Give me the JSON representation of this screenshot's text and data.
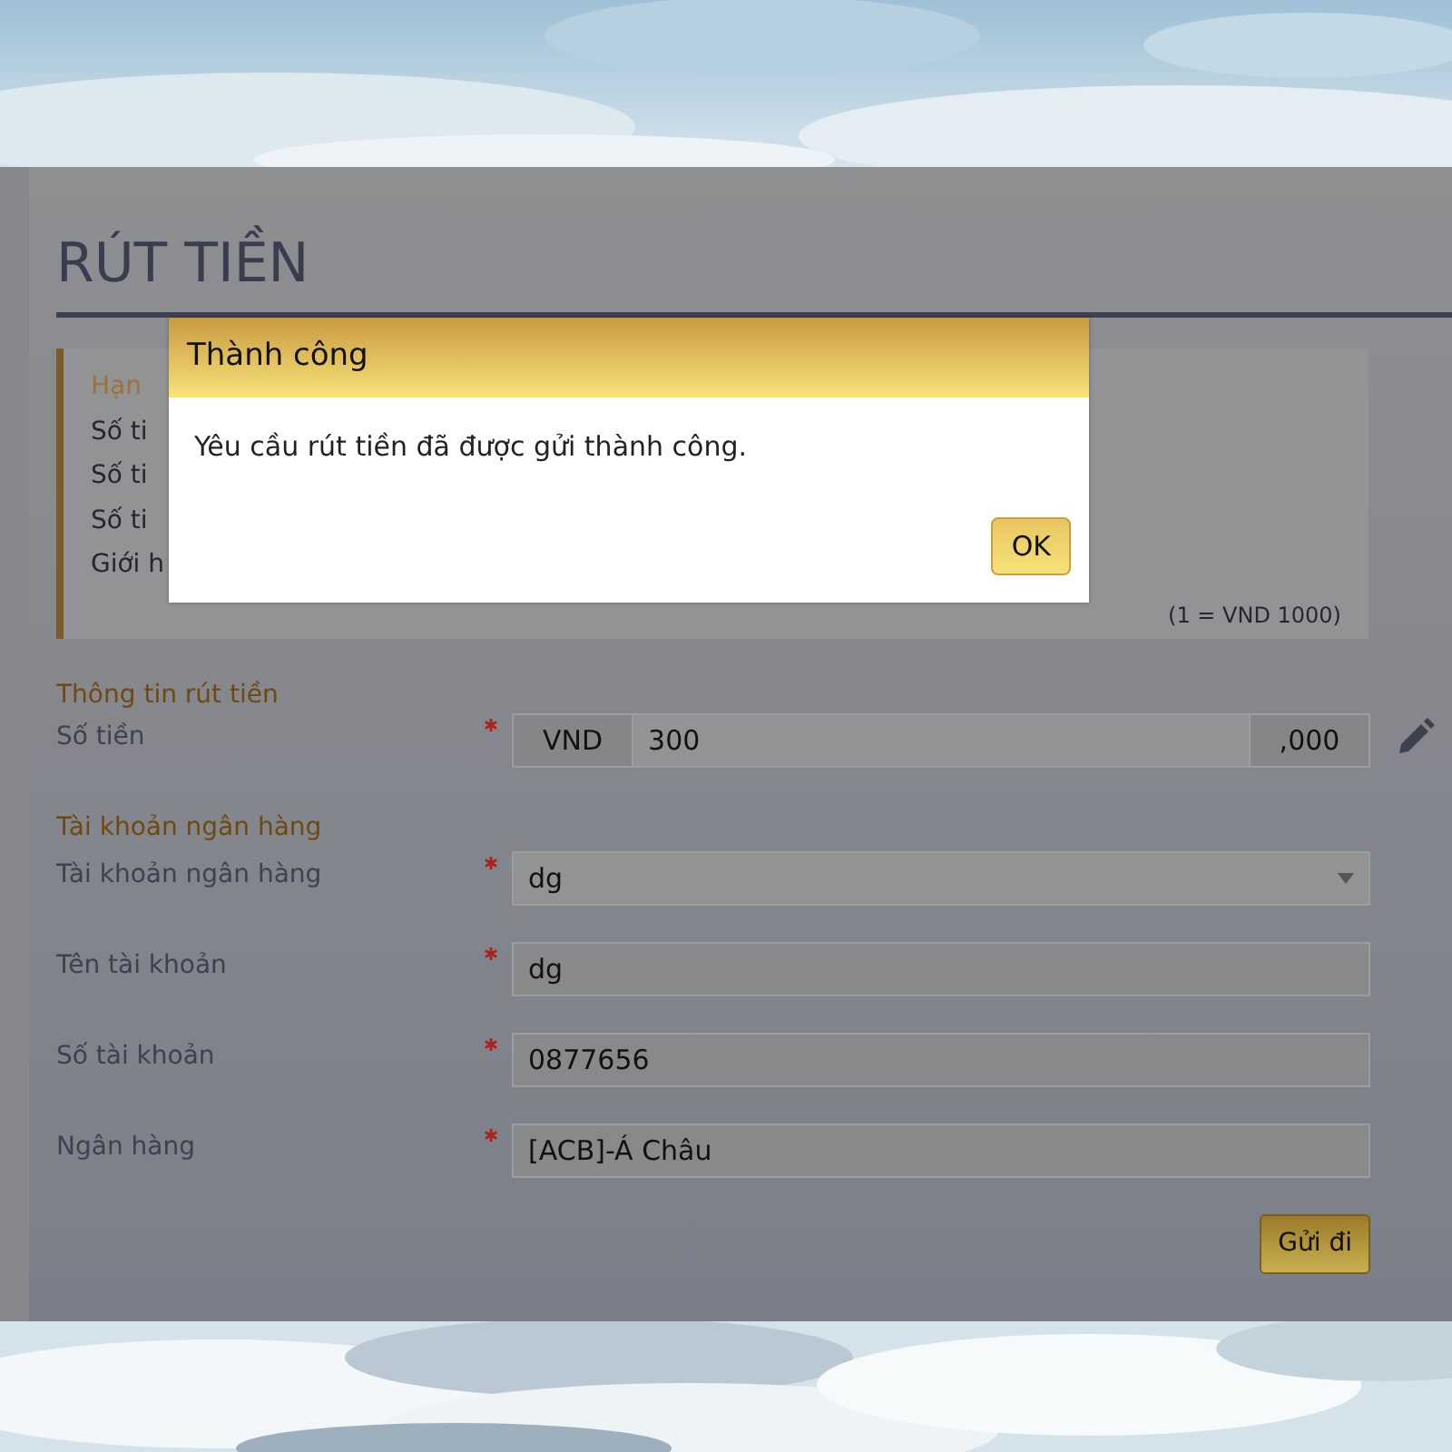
{
  "page": {
    "title": "RÚT TIỀN"
  },
  "limits": {
    "heading": "Hạn",
    "lines": [
      "Số ti",
      "Số ti",
      "Số ti",
      "Giới h"
    ],
    "note": "(1 = VND 1000)"
  },
  "sections": [
    {
      "heading": "Thông tin rút tiền",
      "fields": [
        {
          "label": "Số tiền",
          "required": true,
          "kind": "amount",
          "prefix": "VND",
          "value": "300",
          "suffix": ",000"
        }
      ]
    },
    {
      "heading": "Tài khoản ngân hàng",
      "fields": [
        {
          "label": "Tài khoản ngân hàng",
          "required": true,
          "kind": "select",
          "value": "dg"
        },
        {
          "label": "Tên tài khoản",
          "required": true,
          "kind": "text",
          "value": "dg"
        },
        {
          "label": "Số tài khoản",
          "required": true,
          "kind": "text",
          "value": "0877656"
        },
        {
          "label": "Ngân hàng",
          "required": true,
          "kind": "text",
          "value": "[ACB]-Á Châu"
        }
      ]
    }
  ],
  "submit": "Gửi đi",
  "dialog": {
    "title": "Thành công",
    "message": "Yêu cầu rút tiền đã được gửi thành công.",
    "button": "OK"
  }
}
